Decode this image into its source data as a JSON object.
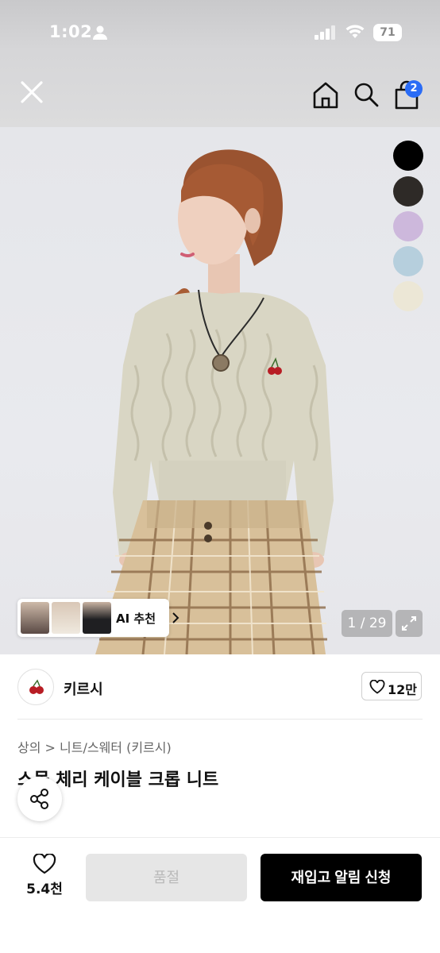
{
  "status_bar": {
    "time": "1:02",
    "battery": "71"
  },
  "header": {
    "cart_count": "2",
    "icons": [
      "close-icon",
      "home-icon",
      "search-icon",
      "shopping-bag-icon"
    ]
  },
  "product_image": {
    "color_swatches": [
      "#000000",
      "#2e2a27",
      "#cdb8dc",
      "#b6cfdd",
      "#ece7d6"
    ],
    "ai_recommend_label": "AI 추천",
    "image_counter": "1 / 29"
  },
  "brand": {
    "name": "키르시",
    "like_count": "12만"
  },
  "product": {
    "breadcrumb": "상의 > 니트/스웨터 (키르시)",
    "title": "스몰 체리 케이블 크롭 니트"
  },
  "bottom_bar": {
    "wish_count": "5.4천",
    "soldout_label": "품절",
    "notify_label": "재입고 알림 신청"
  },
  "colors": {
    "accent_badge": "#2a6cf6",
    "cta_bg": "#000000",
    "disabled_bg": "#e6e6e6"
  }
}
